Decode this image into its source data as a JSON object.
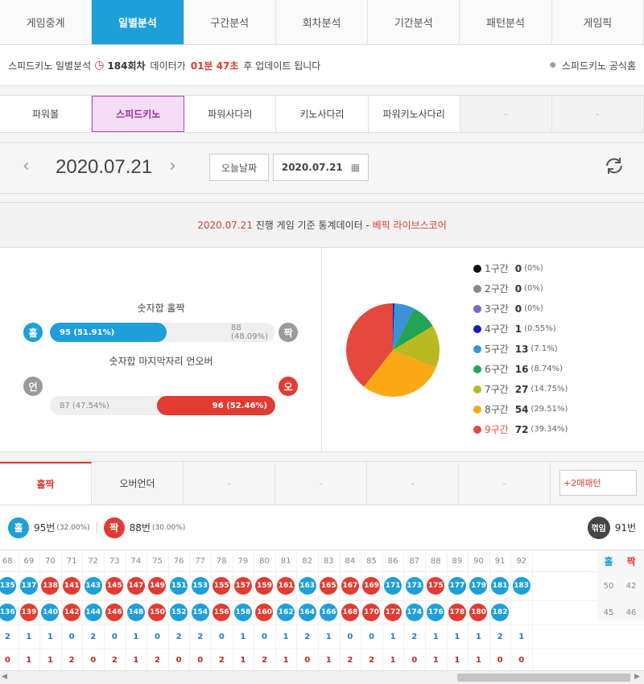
{
  "nav": {
    "tabs": [
      "게임중계",
      "일별분석",
      "구간분석",
      "회차분석",
      "기간분석",
      "패턴분석",
      "게임픽"
    ],
    "active": 1
  },
  "info": {
    "prefix": "스피드키노 일별분석",
    "round": "184회차",
    "mid": "데이터가",
    "time": "01분 47초",
    "suffix": "후 업데이트 됩니다",
    "official": "스피드키노 공식홈"
  },
  "games": {
    "items": [
      "파워볼",
      "스피드키노",
      "파워사다리",
      "키노사다리",
      "파워키노사다리",
      "-",
      "-"
    ],
    "active": 1
  },
  "date": {
    "current": "2020.07.21",
    "today_label": "오늘날짜",
    "picker_value": "2020.07.21"
  },
  "stats_header": {
    "date": "2020.07.21",
    "text": " 진행 게임 기준 통계데이터 - ",
    "brand": "베픽 라이브스코어"
  },
  "odd_even": {
    "title": "숫자합 홀짝",
    "left_label": "홀",
    "right_label": "짝",
    "left_text": "95 (51.91%)",
    "right_text": "88 (48.09%)",
    "left_pct": 51.91
  },
  "under_over": {
    "title": "숫자합 마지막자리 언오버",
    "left_label": "언",
    "right_label": "오",
    "left_text": "87 (47.54%)",
    "right_text": "96 (52.46%)",
    "right_pct": 52.46
  },
  "sections": [
    {
      "label": "1구간",
      "count": "0",
      "pct": "(0%)",
      "color": "#111111",
      "value": 0
    },
    {
      "label": "2구간",
      "count": "0",
      "pct": "(0%)",
      "color": "#888888",
      "value": 0
    },
    {
      "label": "3구간",
      "count": "0",
      "pct": "(0%)",
      "color": "#7b68c8",
      "value": 0
    },
    {
      "label": "4구간",
      "count": "1",
      "pct": "(0.55%)",
      "color": "#1a1ab8",
      "value": 1
    },
    {
      "label": "5구간",
      "count": "13",
      "pct": "(7.1%)",
      "color": "#3a93d8",
      "value": 13
    },
    {
      "label": "6구간",
      "count": "16",
      "pct": "(8.74%)",
      "color": "#22a454",
      "value": 16
    },
    {
      "label": "7구간",
      "count": "27",
      "pct": "(14.75%)",
      "color": "#b9b922",
      "value": 27
    },
    {
      "label": "8구간",
      "count": "54",
      "pct": "(29.51%)",
      "color": "#fba814",
      "value": 54
    },
    {
      "label": "9구간",
      "count": "72",
      "pct": "(39.34%)",
      "color": "#e5483c",
      "value": 72
    }
  ],
  "pattern_tabs": {
    "items": [
      "홀짝",
      "오버언더",
      "-",
      "-",
      "-",
      "-"
    ],
    "extra": "+2매패턴"
  },
  "summary": {
    "odd_label": "홀",
    "odd_text": "95번",
    "odd_pct": "(32.00%)",
    "even_label": "짝",
    "even_text": "88번",
    "even_pct": "(30.00%)",
    "turn_label": "꺾임",
    "turn_text": "91번"
  },
  "pattern": {
    "columns": [
      "68",
      "69",
      "70",
      "71",
      "72",
      "73",
      "74",
      "75",
      "76",
      "77",
      "78",
      "79",
      "80",
      "81",
      "82",
      "83",
      "84",
      "85",
      "86",
      "87",
      "88",
      "89",
      "90",
      "91",
      "92"
    ],
    "row1": [
      [
        "135",
        "b"
      ],
      [
        "137",
        "b"
      ],
      [
        "138",
        "r"
      ],
      [
        "141",
        "r"
      ],
      [
        "143",
        "b"
      ],
      [
        "145",
        "r"
      ],
      [
        "147",
        "r"
      ],
      [
        "149",
        "r"
      ],
      [
        "151",
        "b"
      ],
      [
        "153",
        "b"
      ],
      [
        "155",
        "r"
      ],
      [
        "157",
        "r"
      ],
      [
        "159",
        "r"
      ],
      [
        "161",
        "r"
      ],
      [
        "163",
        "b"
      ],
      [
        "165",
        "r"
      ],
      [
        "167",
        "r"
      ],
      [
        "169",
        "r"
      ],
      [
        "171",
        "b"
      ],
      [
        "173",
        "b"
      ],
      [
        "175",
        "r"
      ],
      [
        "177",
        "b"
      ],
      [
        "179",
        "b"
      ],
      [
        "181",
        "b"
      ],
      [
        "183",
        "b"
      ]
    ],
    "row2": [
      [
        "136",
        "b"
      ],
      [
        "139",
        "r"
      ],
      [
        "140",
        "b"
      ],
      [
        "142",
        "r"
      ],
      [
        "144",
        "b"
      ],
      [
        "146",
        "r"
      ],
      [
        "148",
        "b"
      ],
      [
        "150",
        "r"
      ],
      [
        "152",
        "b"
      ],
      [
        "154",
        "b"
      ],
      [
        "156",
        "r"
      ],
      [
        "158",
        "b"
      ],
      [
        "160",
        "r"
      ],
      [
        "162",
        "b"
      ],
      [
        "164",
        "b"
      ],
      [
        "166",
        "b"
      ],
      [
        "168",
        "r"
      ],
      [
        "170",
        "r"
      ],
      [
        "172",
        "r"
      ],
      [
        "174",
        "b"
      ],
      [
        "176",
        "b"
      ],
      [
        "178",
        "r"
      ],
      [
        "180",
        "r"
      ],
      [
        "182",
        "b"
      ]
    ],
    "row3": [
      "2",
      "1",
      "1",
      "0",
      "2",
      "0",
      "1",
      "0",
      "2",
      "2",
      "0",
      "1",
      "0",
      "1",
      "2",
      "1",
      "0",
      "0",
      "1",
      "2",
      "1",
      "1",
      "1",
      "2",
      "1"
    ],
    "row4": [
      "0",
      "1",
      "1",
      "2",
      "0",
      "2",
      "1",
      "2",
      "0",
      "0",
      "2",
      "1",
      "2",
      "1",
      "0",
      "1",
      "2",
      "2",
      "1",
      "0",
      "1",
      "1",
      "1",
      "0",
      "0"
    ],
    "stat_headers": [
      "홀",
      "짝"
    ],
    "stats": [
      [
        "50",
        "42"
      ],
      [
        "45",
        "46"
      ]
    ]
  }
}
